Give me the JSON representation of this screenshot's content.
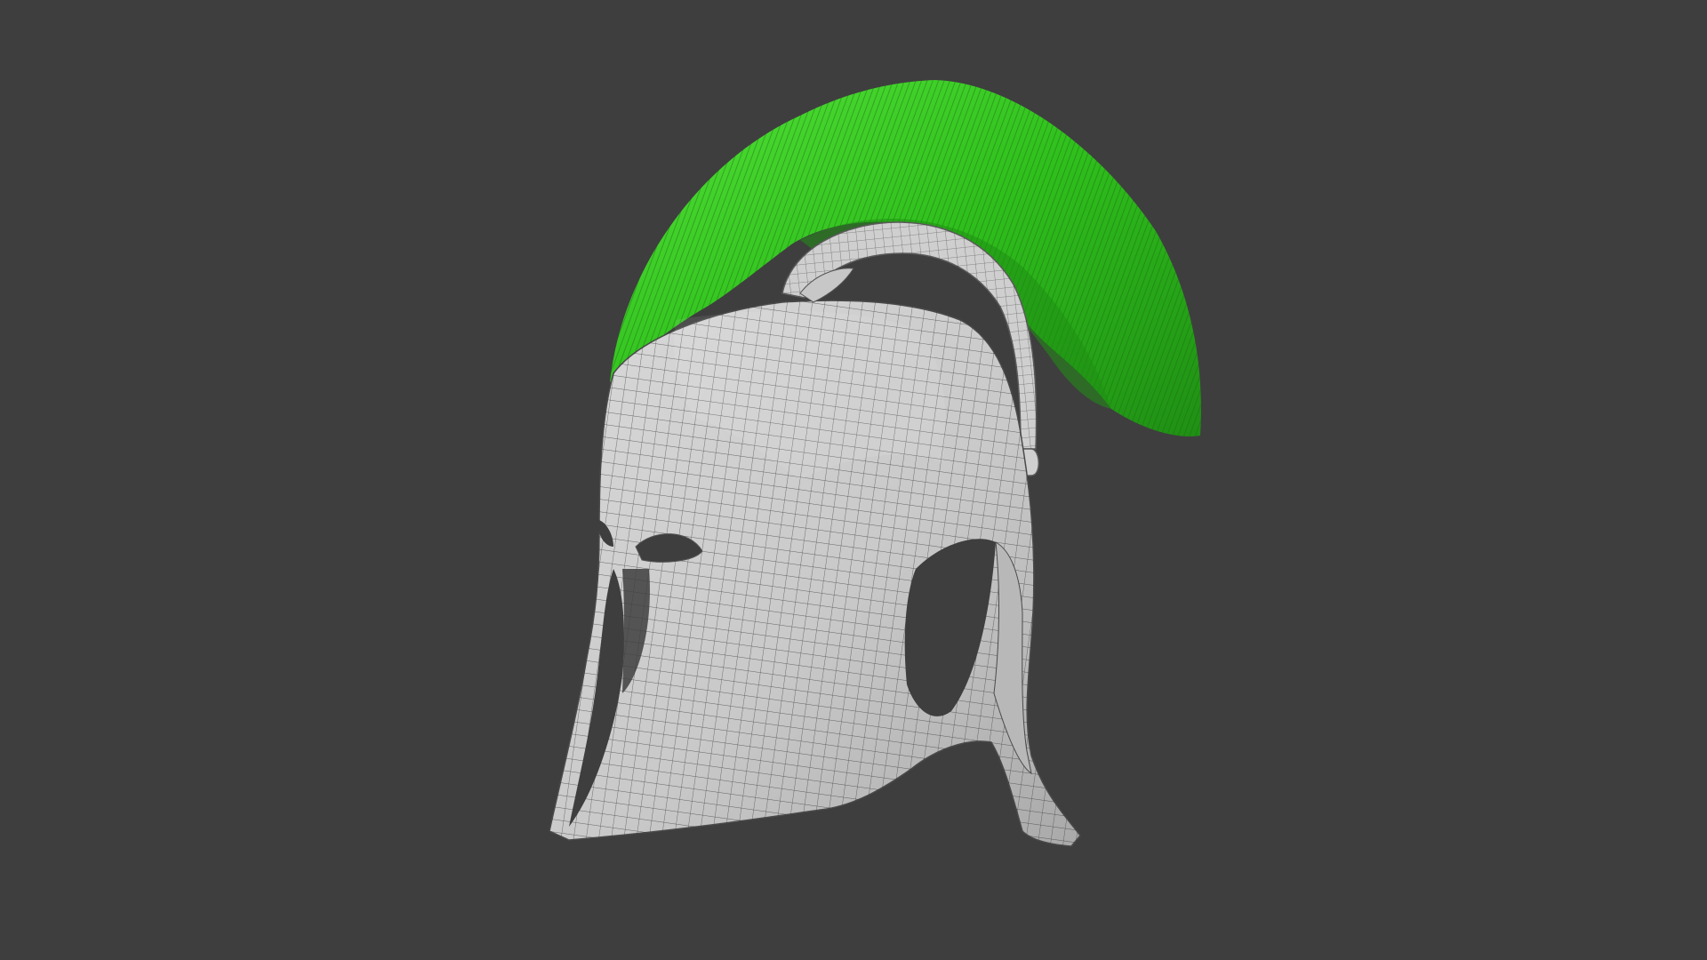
{
  "viewport": {
    "background_color": "#3e3e3e"
  },
  "model": {
    "object": "corinthian-helmet",
    "shading": "solid-wireframe",
    "helmet_color": "#cdcdcd",
    "wire_color": "#2c2c2c",
    "crest": {
      "color": "#2fbf1c",
      "highlight_color": "#55e43a",
      "shadow_color": "#1f8f14"
    },
    "crest_holder_color": "#cfcfcf"
  }
}
